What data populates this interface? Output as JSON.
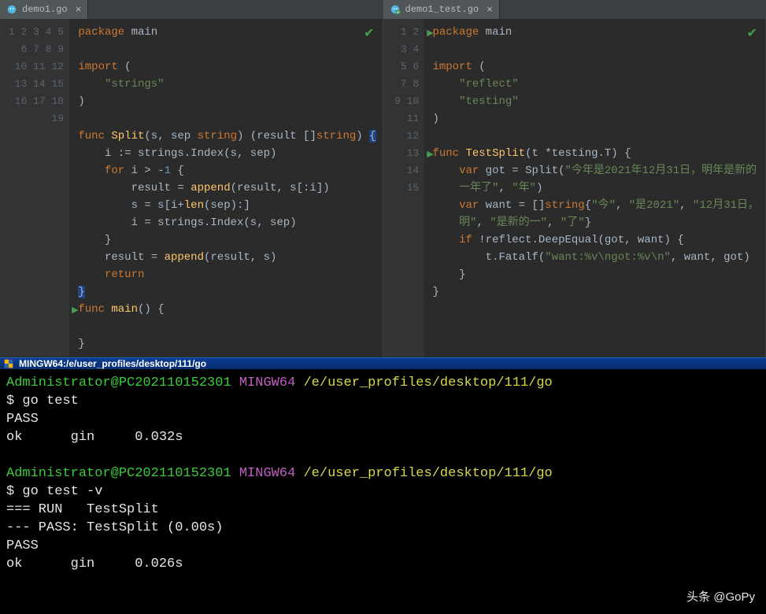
{
  "left": {
    "tab": {
      "filename": "demo1.go"
    },
    "lines": [
      {
        "n": 1,
        "h": "<span class='kw'>package</span> <span class='pkg'>main</span>"
      },
      {
        "n": 2,
        "h": ""
      },
      {
        "n": 3,
        "h": "<span class='kw'>import</span> ("
      },
      {
        "n": 4,
        "h": "    <span class='str'>\"strings\"</span>"
      },
      {
        "n": 5,
        "h": ")"
      },
      {
        "n": 6,
        "h": ""
      },
      {
        "n": 7,
        "h": "<span class='kw'>func</span> <span class='fn'>Split</span>(s, sep <span class='ty'>string</span>) (result []<span class='ty'>string</span>) <span class='hlb'>{</span>"
      },
      {
        "n": 8,
        "h": "    i := strings.Index(s, sep)"
      },
      {
        "n": 9,
        "h": "    <span class='kw'>for</span> i &gt; -<span class='num'>1</span> {"
      },
      {
        "n": 10,
        "h": "        result = <span class='fn'>append</span>(result, s[:i])"
      },
      {
        "n": 11,
        "h": "        s = s[i+<span class='fn'>len</span>(sep):]"
      },
      {
        "n": 12,
        "h": "        i = strings.Index(s, sep)"
      },
      {
        "n": 13,
        "h": "    }"
      },
      {
        "n": 14,
        "h": "    result = <span class='fn'>append</span>(result, s)"
      },
      {
        "n": 15,
        "h": "    <span class='kw'>return</span>"
      },
      {
        "n": 16,
        "h": "<span class='hlb'>}</span>"
      },
      {
        "n": 17,
        "h": "<span class='kw'>func</span> <span class='fn'>main</span>() {",
        "run": true
      },
      {
        "n": 18,
        "h": ""
      },
      {
        "n": 19,
        "h": "}"
      }
    ]
  },
  "right": {
    "tab": {
      "filename": "demo1_test.go"
    },
    "lines": [
      {
        "n": 1,
        "h": "<span class='kw'>package</span> <span class='pkg'>main</span>",
        "run": true
      },
      {
        "n": 2,
        "h": ""
      },
      {
        "n": 3,
        "h": "<span class='kw'>import</span> ("
      },
      {
        "n": 4,
        "h": "    <span class='str'>\"reflect\"</span>"
      },
      {
        "n": 5,
        "h": "    <span class='str'>\"testing\"</span>"
      },
      {
        "n": 6,
        "h": ")"
      },
      {
        "n": 7,
        "h": ""
      },
      {
        "n": 8,
        "h": "<span class='kw'>func</span> <span class='fn'>TestSplit</span>(t *testing.T) {",
        "run": true
      },
      {
        "n": 9,
        "h": "    <span class='kw'>var</span> got = Split(<span class='str'>\"今年是2021年12月31日，明年是新的</span>",
        "wrap": "<span class='str'>一年了\"</span>, <span class='str'>\"年\"</span>)"
      },
      {
        "n": 10,
        "h": "    <span class='kw'>var</span> want = []<span class='ty'>string</span>{<span class='str'>\"今\"</span>, <span class='str'>\"是2021\"</span>, <span class='str'>\"12月31日，</span>",
        "wrap": "<span class='str'>明\"</span>, <span class='str'>\"是新的一\"</span>, <span class='str'>\"了\"</span>}"
      },
      {
        "n": 11,
        "h": "    <span class='kw'>if</span> !reflect.DeepEqual(got, want) {"
      },
      {
        "n": 12,
        "h": "        t.Fatalf(<span class='str'>\"want:%v\\ngot:%v\\n\"</span>, want, got)"
      },
      {
        "n": 13,
        "h": "    }"
      },
      {
        "n": 14,
        "h": "}"
      },
      {
        "n": 15,
        "h": ""
      }
    ]
  },
  "terminal": {
    "title": "MINGW64:/e/user_profiles/desktop/111/go",
    "lines": [
      {
        "h": "<span class='t-green'>Administrator@PC202110152301</span> <span class='t-mag'>MINGW64</span> <span class='t-yel'>/e/user_profiles/desktop/111/go</span>"
      },
      {
        "h": "<span class='t-white'>$ go test</span>"
      },
      {
        "h": "<span class='t-white'>PASS</span>"
      },
      {
        "h": "<span class='t-white'>ok      gin     0.032s</span>"
      },
      {
        "h": ""
      },
      {
        "h": "<span class='t-green'>Administrator@PC202110152301</span> <span class='t-mag'>MINGW64</span> <span class='t-yel'>/e/user_profiles/desktop/111/go</span>"
      },
      {
        "h": "<span class='t-white'>$ go test -v</span>"
      },
      {
        "h": "<span class='t-white'>=== RUN   TestSplit</span>"
      },
      {
        "h": "<span class='t-white'>--- PASS: TestSplit (0.00s)</span>"
      },
      {
        "h": "<span class='t-white'>PASS</span>"
      },
      {
        "h": "<span class='t-white'>ok      gin     0.026s</span>"
      }
    ],
    "watermark": "头条 @GoPy"
  }
}
